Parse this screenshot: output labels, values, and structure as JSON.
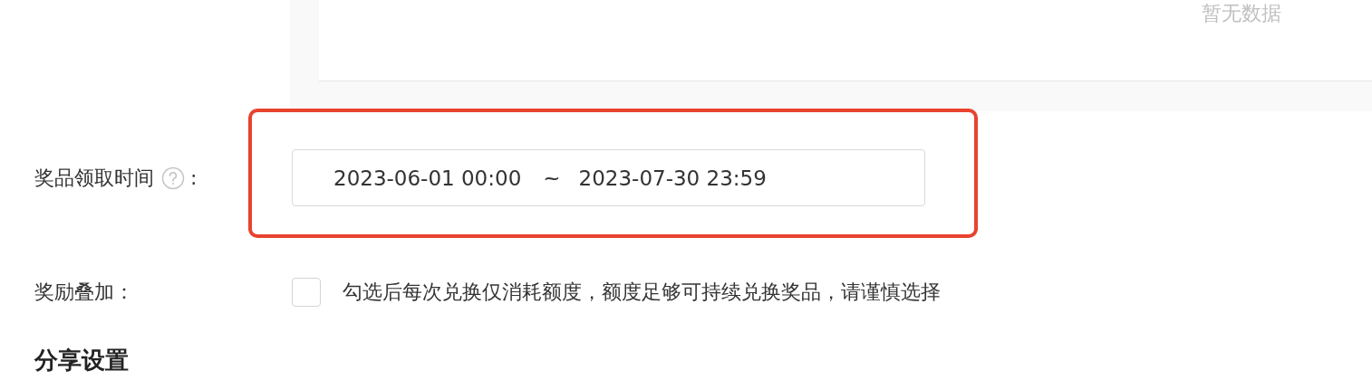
{
  "table": {
    "empty_text": "暂无数据"
  },
  "fields": [
    {
      "kind": "daterange",
      "label": "奖品领取时间",
      "help": true,
      "suffix": ":",
      "highlighted": true,
      "start": "2023-06-01 00:00",
      "separator": "~",
      "end": "2023-07-30 23:59"
    },
    {
      "kind": "checkbox",
      "label": "奖励叠加：",
      "checked": false,
      "text": "勾选后每次兑换仅消耗额度，额度足够可持续兑换奖品，请谨慎选择"
    }
  ],
  "section_title": "分享设置"
}
